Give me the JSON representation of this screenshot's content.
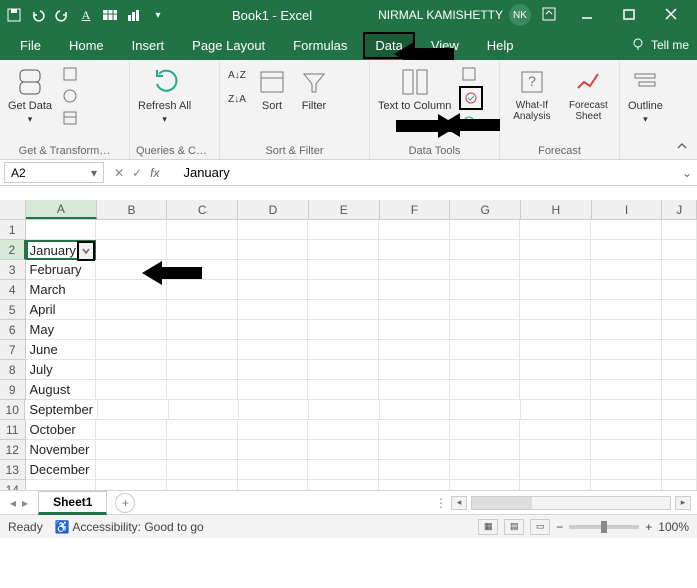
{
  "titlebar": {
    "doc_title": "Book1 - Excel",
    "user_name": "NIRMAL KAMISHETTY",
    "user_initials": "NK"
  },
  "tabs": {
    "file": "File",
    "home": "Home",
    "insert": "Insert",
    "pagelayout": "Page Layout",
    "formulas": "Formulas",
    "data": "Data",
    "view": "View",
    "help": "Help",
    "tellme": "Tell me"
  },
  "ribbon": {
    "get_data": "Get Data",
    "group_get_transform": "Get & Transform…",
    "refresh_all": "Refresh All",
    "group_queries": "Queries & Co…",
    "sort": "Sort",
    "filter": "Filter",
    "group_sort_filter": "Sort & Filter",
    "text_to_columns": "Text to Column",
    "group_data_tools": "Data Tools",
    "whatif": "What-If Analysis",
    "forecast_sheet": "Forecast Sheet",
    "group_forecast": "Forecast",
    "outline": "Outline"
  },
  "formula_bar": {
    "name_box": "A2",
    "formula": "January"
  },
  "columns": [
    "A",
    "B",
    "C",
    "D",
    "E",
    "F",
    "G",
    "H",
    "I",
    "J"
  ],
  "rows_data": [
    {
      "n": "1",
      "val": ""
    },
    {
      "n": "2",
      "val": "January"
    },
    {
      "n": "3",
      "val": "February"
    },
    {
      "n": "4",
      "val": "March"
    },
    {
      "n": "5",
      "val": "April"
    },
    {
      "n": "6",
      "val": "May"
    },
    {
      "n": "7",
      "val": "June"
    },
    {
      "n": "8",
      "val": "July"
    },
    {
      "n": "9",
      "val": "August"
    },
    {
      "n": "10",
      "val": "September"
    },
    {
      "n": "11",
      "val": "October"
    },
    {
      "n": "12",
      "val": "November"
    },
    {
      "n": "13",
      "val": "December"
    },
    {
      "n": "14",
      "val": ""
    }
  ],
  "sheet": {
    "name": "Sheet1"
  },
  "status": {
    "ready": "Ready",
    "accessibility": "Accessibility: Good to go",
    "zoom": "100%"
  }
}
